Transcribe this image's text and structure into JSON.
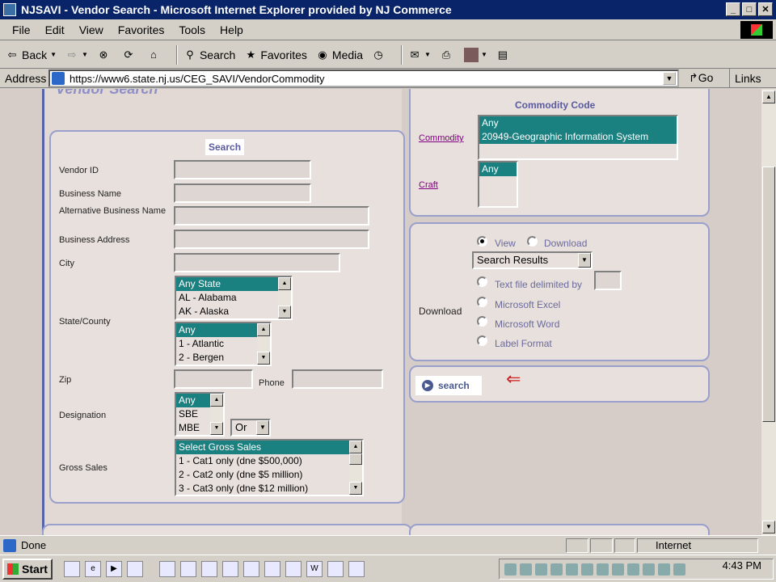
{
  "window": {
    "title": "NJSAVI - Vendor Search - Microsoft Internet Explorer provided by NJ Commerce"
  },
  "menu": [
    "File",
    "Edit",
    "View",
    "Favorites",
    "Tools",
    "Help"
  ],
  "toolbar": {
    "back": "Back",
    "search": "Search",
    "favorites": "Favorites",
    "media": "Media"
  },
  "address": {
    "label": "Address",
    "url": "https://www6.state.nj.us/CEG_SAVI/VendorCommodity",
    "go": "Go",
    "links": "Links"
  },
  "page": {
    "heading": "Vendor Search",
    "search_legend": "Search",
    "labels": {
      "vendor_id": "Vendor ID",
      "business_name": "Business Name",
      "alt_business_name": "Alternative Business Name",
      "business_address": "Business Address",
      "city": "City",
      "state_county": "State/County",
      "zip": "Zip",
      "phone": "Phone",
      "designation": "Designation",
      "gross_sales": "Gross Sales"
    },
    "state_options": [
      "Any State",
      "AL - Alabama",
      "AK - Alaska"
    ],
    "county_options": [
      "Any",
      "1 - Atlantic",
      "2 - Bergen"
    ],
    "designation_options": [
      "Any",
      "SBE",
      "MBE"
    ],
    "designation_operator": "Or",
    "gross_sales_options": [
      "Select Gross Sales",
      "1 - Cat1 only (dne $500,000)",
      "2 - Cat2 only (dne $5 million)",
      "3 - Cat3 only (dne $12 million)"
    ],
    "commodity_code_heading": "Commodity Code",
    "commodity_link": "Commodity",
    "commodity_options": [
      "Any",
      "20949-Geographic Information System"
    ],
    "craft_link": "Craft",
    "craft_options": [
      "Any"
    ],
    "download": {
      "label": "Download",
      "view": "View",
      "download": "Download",
      "results_select": "Search Results",
      "text_file": "Text file delimited by",
      "excel": "Microsoft Excel",
      "word": "Microsoft Word",
      "label_format": "Label Format"
    },
    "search_button": "search",
    "arrow_mark": "⇐"
  },
  "status": {
    "text": "Done",
    "zone": "Internet"
  },
  "taskbar": {
    "start": "Start",
    "clock": "4:43 PM"
  }
}
